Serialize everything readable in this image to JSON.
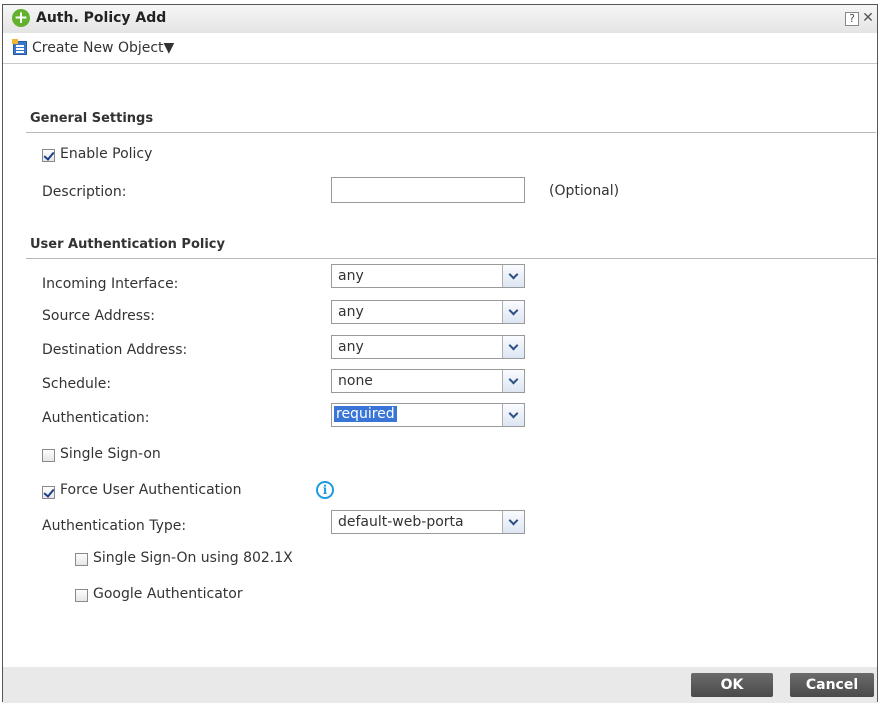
{
  "dialog": {
    "title": "Auth. Policy Add",
    "help_label": "?",
    "close_label": "✕"
  },
  "toolbar": {
    "create_new_object_label": "Create New Object▼"
  },
  "general_settings": {
    "title": "General Settings",
    "enable_policy": {
      "label": "Enable Policy",
      "checked": true
    },
    "description": {
      "label": "Description:",
      "value": "",
      "hint": "(Optional)"
    }
  },
  "user_auth_policy": {
    "title": "User Authentication Policy",
    "incoming_interface": {
      "label": "Incoming Interface:",
      "value": "any"
    },
    "source_address": {
      "label": "Source Address:",
      "value": "any"
    },
    "destination_address": {
      "label": "Destination Address:",
      "value": "any"
    },
    "schedule": {
      "label": "Schedule:",
      "value": "none"
    },
    "authentication": {
      "label": "Authentication:",
      "value": "required"
    },
    "single_sign_on": {
      "label": "Single Sign-on",
      "checked": false
    },
    "force_user_auth": {
      "label": "Force User Authentication",
      "checked": true
    },
    "authentication_type": {
      "label": "Authentication Type:",
      "value": "default-web-porta"
    },
    "sso_8021x": {
      "label": "Single Sign-On using 802.1X",
      "checked": false
    },
    "google_authenticator": {
      "label": "Google Authenticator",
      "checked": false
    }
  },
  "footer": {
    "ok_label": "OK",
    "cancel_label": "Cancel"
  }
}
